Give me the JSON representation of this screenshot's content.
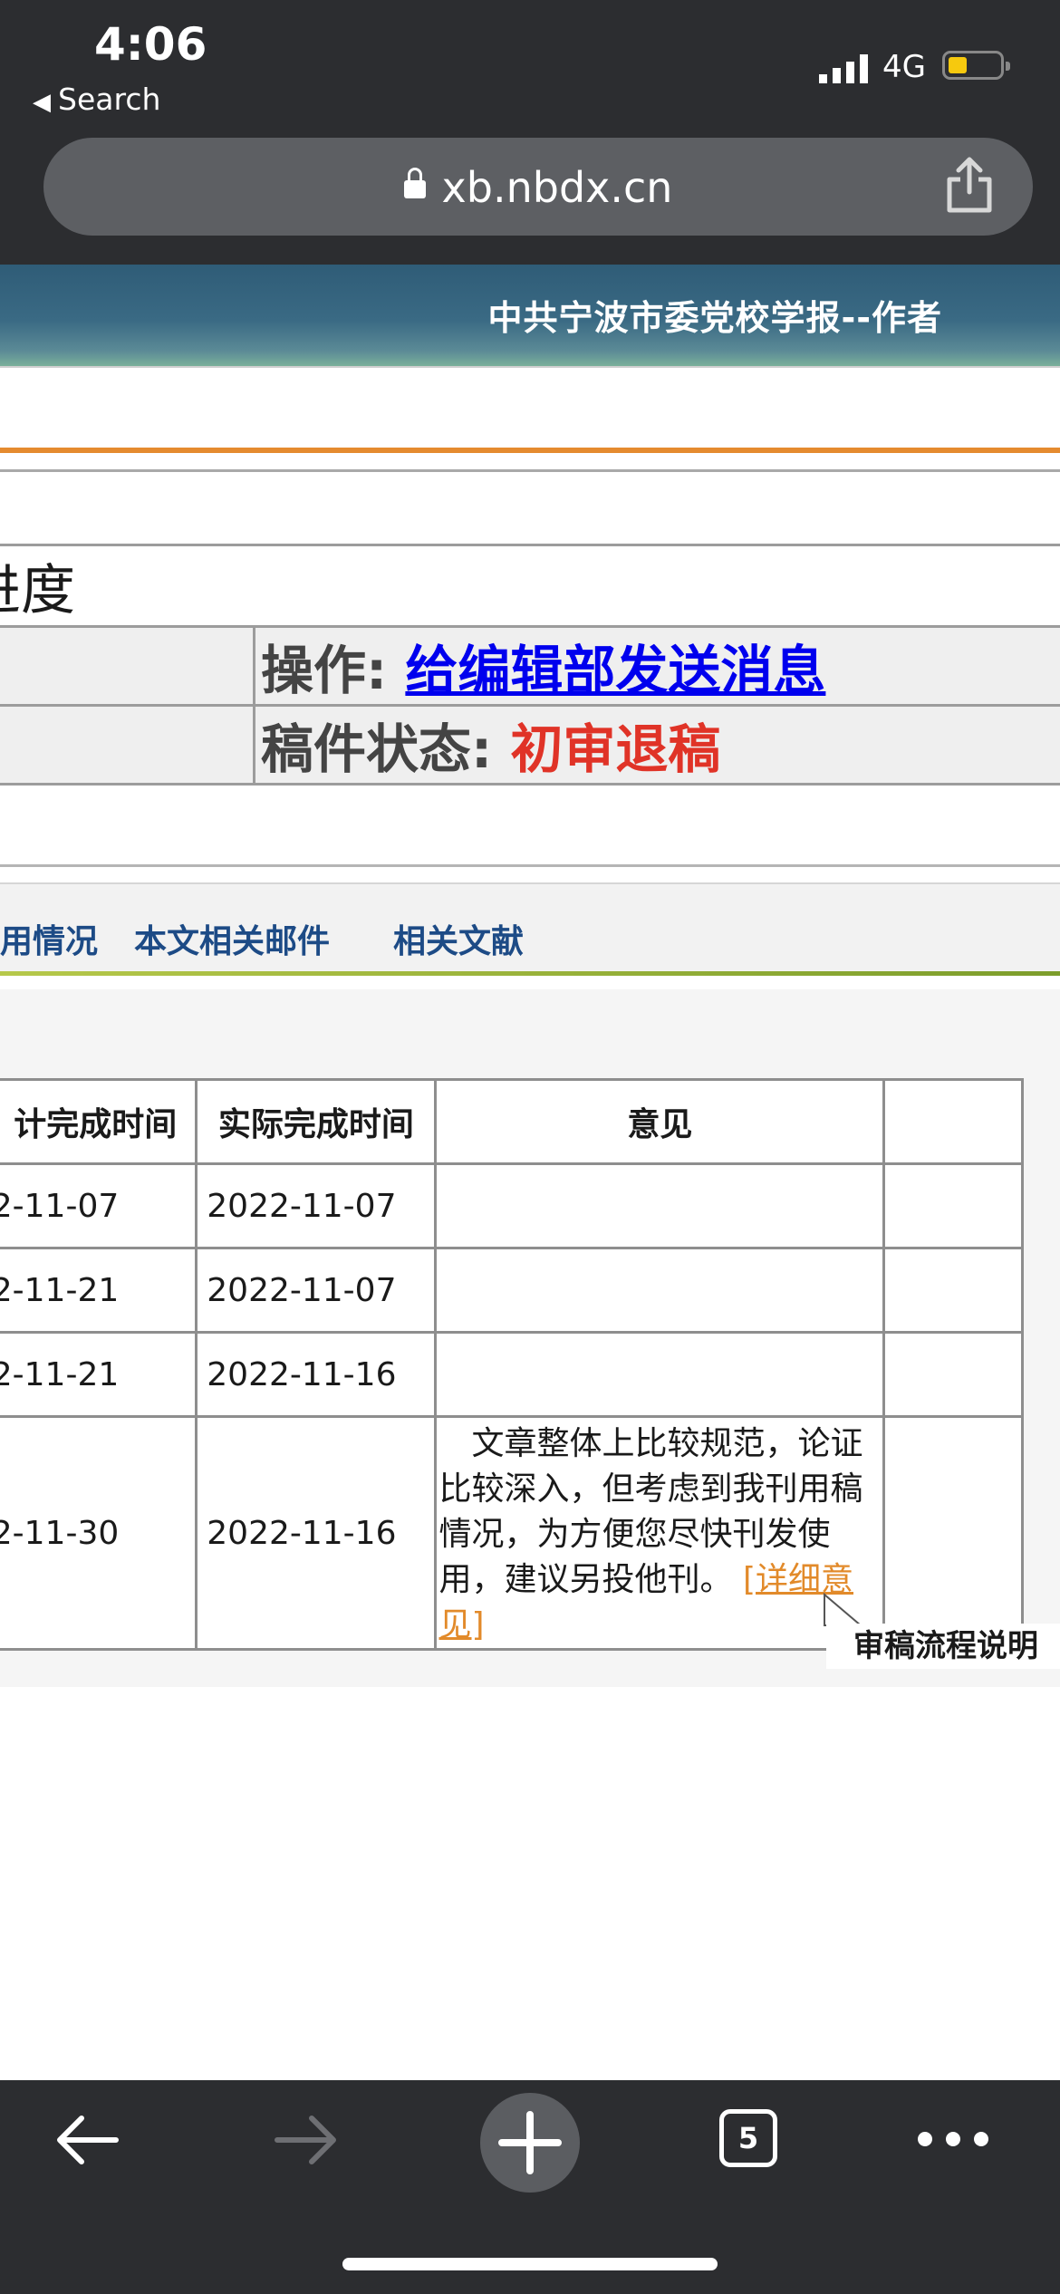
{
  "status_bar": {
    "time": "4:06",
    "back_app": "Search",
    "network": "4G"
  },
  "browser": {
    "url": "xb.nbdx.cn",
    "tab_count": "5"
  },
  "site": {
    "title": "中共宁波市委党校学报--作者"
  },
  "info": {
    "heading": "进度",
    "operation_label": "操作: ",
    "operation_link": "给编辑部发送消息",
    "status_label": "稿件状态: ",
    "status_value": "初审退稿"
  },
  "tabs": [
    {
      "label": "用情况"
    },
    {
      "label": "本文相关邮件"
    },
    {
      "label": "相关文献"
    }
  ],
  "review_table": {
    "headers": [
      "计完成时间",
      "实际完成时间",
      "意见",
      ""
    ],
    "rows": [
      {
        "planned": "2-11-07",
        "actual": "2022-11-07",
        "opinion": ""
      },
      {
        "planned": "2-11-21",
        "actual": "2022-11-07",
        "opinion": ""
      },
      {
        "planned": "2-11-21",
        "actual": "2022-11-16",
        "opinion": ""
      },
      {
        "planned": "2-11-30",
        "actual": "2022-11-16",
        "opinion": "文章整体上比较规范，论证比较深入，但考虑到我刊用稿情况，为方便您尽快刊发使用，建议另投他刊。",
        "detail_link": "[详细意见]"
      }
    ]
  },
  "flow_label": "审稿流程说明",
  "colors": {
    "header_blue": "#2f5c77",
    "accent_orange": "#e58b2f",
    "status_red": "#e03327",
    "link_blue": "#0000ee"
  }
}
